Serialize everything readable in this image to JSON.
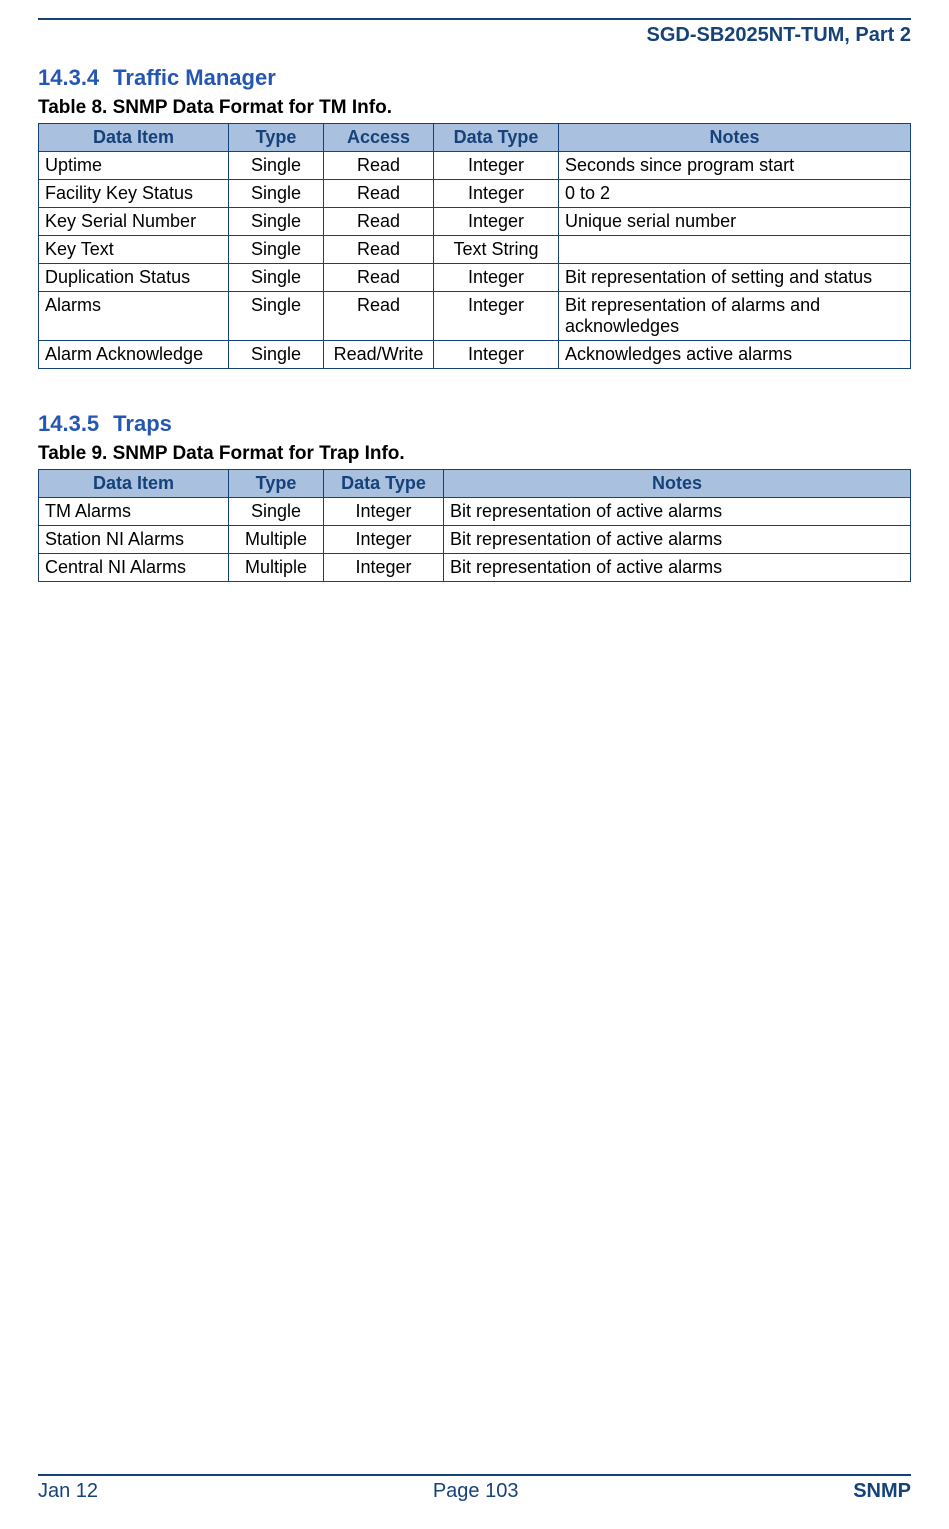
{
  "header": {
    "doc_id": "SGD-SB2025NT-TUM, Part 2"
  },
  "section1": {
    "number": "14.3.4",
    "title": "Traffic Manager",
    "caption": "Table 8.  SNMP Data Format for TM Info.",
    "columns": [
      "Data Item",
      "Type",
      "Access",
      "Data Type",
      "Notes"
    ],
    "rows": [
      {
        "item": "Uptime",
        "type": "Single",
        "access": "Read",
        "dtype": "Integer",
        "notes": "Seconds since program start"
      },
      {
        "item": "Facility Key Status",
        "type": "Single",
        "access": "Read",
        "dtype": "Integer",
        "notes": "0 to 2"
      },
      {
        "item": "Key Serial Number",
        "type": "Single",
        "access": "Read",
        "dtype": "Integer",
        "notes": "Unique serial number"
      },
      {
        "item": "Key Text",
        "type": "Single",
        "access": "Read",
        "dtype": "Text String",
        "notes": ""
      },
      {
        "item": "Duplication Status",
        "type": "Single",
        "access": "Read",
        "dtype": "Integer",
        "notes": "Bit representation of setting and status"
      },
      {
        "item": "Alarms",
        "type": "Single",
        "access": "Read",
        "dtype": "Integer",
        "notes": "Bit representation of alarms and acknowledges"
      },
      {
        "item": "Alarm Acknowledge",
        "type": "Single",
        "access": "Read/Write",
        "dtype": "Integer",
        "notes": "Acknowledges active alarms"
      }
    ]
  },
  "section2": {
    "number": "14.3.5",
    "title": "Traps",
    "caption": "Table 9.  SNMP Data Format for Trap Info.",
    "columns": [
      "Data Item",
      "Type",
      "Data Type",
      "Notes"
    ],
    "rows": [
      {
        "item": "TM Alarms",
        "type": "Single",
        "dtype": "Integer",
        "notes": "Bit representation of active alarms"
      },
      {
        "item": "Station NI Alarms",
        "type": "Multiple",
        "dtype": "Integer",
        "notes": "Bit representation of active alarms"
      },
      {
        "item": "Central NI Alarms",
        "type": "Multiple",
        "dtype": "Integer",
        "notes": "Bit representation of active alarms"
      }
    ]
  },
  "footer": {
    "left": "Jan 12",
    "center": "Page 103",
    "right": "SNMP"
  }
}
